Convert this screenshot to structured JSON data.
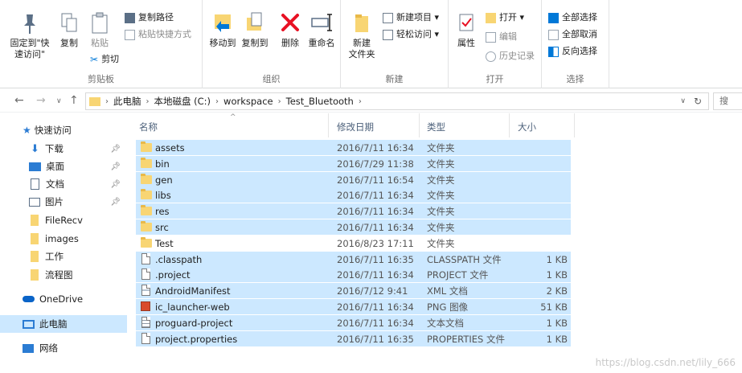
{
  "ribbon": {
    "clipboard": {
      "pin_label": "固定到\"快\n速访问\"",
      "copy_label": "复制",
      "paste_label": "粘贴",
      "copy_path": "复制路径",
      "paste_shortcut": "粘贴快捷方式",
      "cut": "剪切",
      "group_label": "剪贴板"
    },
    "organize": {
      "move_to": "移动到",
      "copy_to": "复制到",
      "delete": "删除",
      "rename": "重命名",
      "group_label": "组织"
    },
    "new": {
      "new_folder": "新建\n文件夹",
      "new_item": "新建项目 ▾",
      "easy_access": "轻松访问 ▾",
      "group_label": "新建"
    },
    "open": {
      "properties": "属性",
      "open": "打开 ▾",
      "edit": "编辑",
      "history": "历史记录",
      "group_label": "打开"
    },
    "select": {
      "select_all": "全部选择",
      "select_none": "全部取消",
      "invert": "反向选择",
      "group_label": "选择"
    }
  },
  "address": {
    "crumbs": [
      "此电脑",
      "本地磁盘 (C:)",
      "workspace",
      "Test_Bluetooth"
    ],
    "search_placeholder": "搜"
  },
  "nav": {
    "quick_access": "快速访问",
    "items": [
      {
        "label": "下载",
        "pinned": true
      },
      {
        "label": "桌面",
        "pinned": true
      },
      {
        "label": "文档",
        "pinned": true
      },
      {
        "label": "图片",
        "pinned": true
      },
      {
        "label": "FileRecv",
        "pinned": false
      },
      {
        "label": "images",
        "pinned": false
      },
      {
        "label": "工作",
        "pinned": false
      },
      {
        "label": "流程图",
        "pinned": false
      }
    ],
    "onedrive": "OneDrive",
    "this_pc": "此电脑",
    "network": "网络"
  },
  "columns": {
    "name": "名称",
    "date": "修改日期",
    "type": "类型",
    "size": "大小"
  },
  "files": [
    {
      "name": "assets",
      "date": "2016/7/11 16:34",
      "type": "文件夹",
      "size": "",
      "kind": "folder",
      "selected": true
    },
    {
      "name": "bin",
      "date": "2016/7/29 11:38",
      "type": "文件夹",
      "size": "",
      "kind": "folder",
      "selected": true
    },
    {
      "name": "gen",
      "date": "2016/7/11 16:54",
      "type": "文件夹",
      "size": "",
      "kind": "folder",
      "selected": true
    },
    {
      "name": "libs",
      "date": "2016/7/11 16:34",
      "type": "文件夹",
      "size": "",
      "kind": "folder",
      "selected": true
    },
    {
      "name": "res",
      "date": "2016/7/11 16:34",
      "type": "文件夹",
      "size": "",
      "kind": "folder",
      "selected": true
    },
    {
      "name": "src",
      "date": "2016/7/11 16:34",
      "type": "文件夹",
      "size": "",
      "kind": "folder",
      "selected": true
    },
    {
      "name": "Test",
      "date": "2016/8/23 17:11",
      "type": "文件夹",
      "size": "",
      "kind": "folder",
      "selected": false
    },
    {
      "name": ".classpath",
      "date": "2016/7/11 16:35",
      "type": "CLASSPATH 文件",
      "size": "1 KB",
      "kind": "doc",
      "selected": true
    },
    {
      "name": ".project",
      "date": "2016/7/11 16:34",
      "type": "PROJECT 文件",
      "size": "1 KB",
      "kind": "doc",
      "selected": true
    },
    {
      "name": "AndroidManifest",
      "date": "2016/7/12 9:41",
      "type": "XML 文档",
      "size": "2 KB",
      "kind": "xml",
      "selected": true
    },
    {
      "name": "ic_launcher-web",
      "date": "2016/7/11 16:34",
      "type": "PNG 图像",
      "size": "51 KB",
      "kind": "png",
      "selected": true
    },
    {
      "name": "proguard-project",
      "date": "2016/7/11 16:34",
      "type": "文本文档",
      "size": "1 KB",
      "kind": "txt",
      "selected": true
    },
    {
      "name": "project.properties",
      "date": "2016/7/11 16:35",
      "type": "PROPERTIES 文件",
      "size": "1 KB",
      "kind": "doc",
      "selected": true
    }
  ],
  "watermark": "https://blog.csdn.net/lily_666",
  "colors": {
    "selection": "#cce8ff",
    "folder": "#f8d573",
    "accent": "#0078d7",
    "delete": "#e81123"
  }
}
